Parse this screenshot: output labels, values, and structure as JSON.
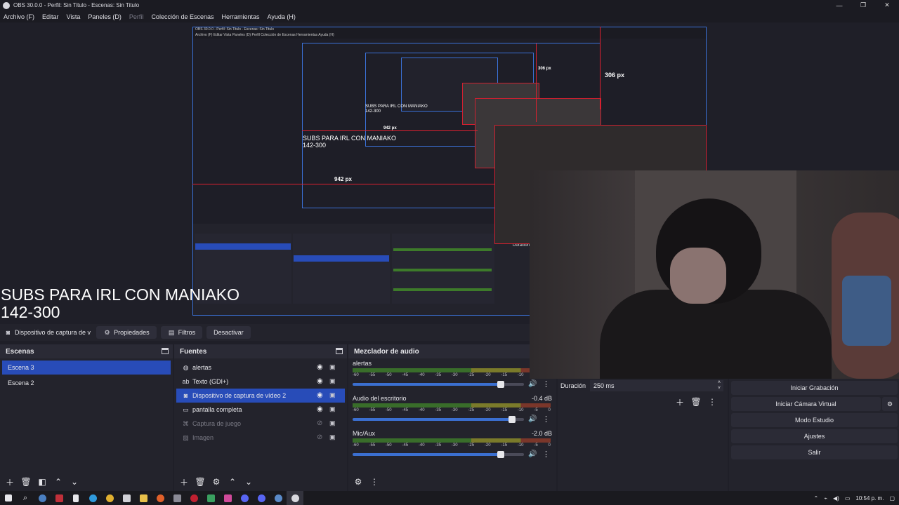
{
  "window": {
    "title": "OBS 30.0.0 - Perfil: Sin Titulo - Escenas: Sin Titulo",
    "minimize": "—",
    "maximize": "❐",
    "close": "✕"
  },
  "menu": {
    "items": [
      "Archivo (F)",
      "Editar",
      "Vista",
      "Paneles (D)",
      "Perfil",
      "Colección de Escenas",
      "Herramientas",
      "Ayuda (H)"
    ]
  },
  "preview": {
    "nested_title": "OBS 30.0.0 - Perfil: Sin Titulo - Escenas: Sin Titulo",
    "nested_menu": "Archivo (F)   Editar   Vista   Paneles (D)   Perfil   Colección de Escenas   Herramientas   Ayuda (H)",
    "overlay_line1": "SUBS PARA IRL CON MANIAKO",
    "overlay_line2": "142-300",
    "dim_height": "306 px",
    "dim_width": "942 px",
    "nested_duration": "Duración"
  },
  "source_toolbar": {
    "selected_source": "Dispositivo de captura de v",
    "properties": "Propiedades",
    "filters": "Filtros",
    "deactivate": "Desactivar"
  },
  "scenes": {
    "header": "Escenas",
    "items": [
      {
        "label": "Escena 3",
        "selected": true
      },
      {
        "label": "Escena 2",
        "selected": false
      }
    ]
  },
  "sources": {
    "header": "Fuentes",
    "items": [
      {
        "label": "alertas",
        "icon": "globe-icon",
        "visible": true
      },
      {
        "label": "Texto (GDI+)",
        "icon": "text-icon",
        "visible": true
      },
      {
        "label": "Dispositivo de captura de vídeo 2",
        "icon": "camera-icon",
        "visible": true,
        "selected": true
      },
      {
        "label": "pantalla completa",
        "icon": "monitor-icon",
        "visible": true
      },
      {
        "label": "Captura de juego",
        "icon": "gamepad-icon",
        "visible": false
      },
      {
        "label": "Imagen",
        "icon": "image-icon",
        "visible": false
      }
    ]
  },
  "mixer": {
    "header": "Mezclador de audio",
    "ticks": [
      "-60",
      "-55",
      "-50",
      "-45",
      "-40",
      "-35",
      "-30",
      "-25",
      "-20",
      "-15",
      "-10",
      "-5",
      "0"
    ],
    "tracks": [
      {
        "name": "alertas",
        "db": "",
        "level": 0.88
      },
      {
        "name": "Audio del escritorio",
        "db": "-0.4 dB",
        "level": 0.95
      },
      {
        "name": "Mic/Aux",
        "db": "-2.0 dB",
        "level": 0.88
      }
    ]
  },
  "transitions": {
    "duration_label": "Duración",
    "duration_value": "250 ms"
  },
  "controls": {
    "start_recording": "Iniciar Grabación",
    "start_virtual_cam": "Iniciar Cámara Virtual",
    "studio_mode": "Modo Estudio",
    "settings": "Ajustes",
    "exit": "Salir"
  },
  "taskbar": {
    "time": "10:54 p. m."
  },
  "colors": {
    "accent": "#284cb8",
    "highlight_border": "#3b71d8",
    "red_guides": "#e02030"
  }
}
